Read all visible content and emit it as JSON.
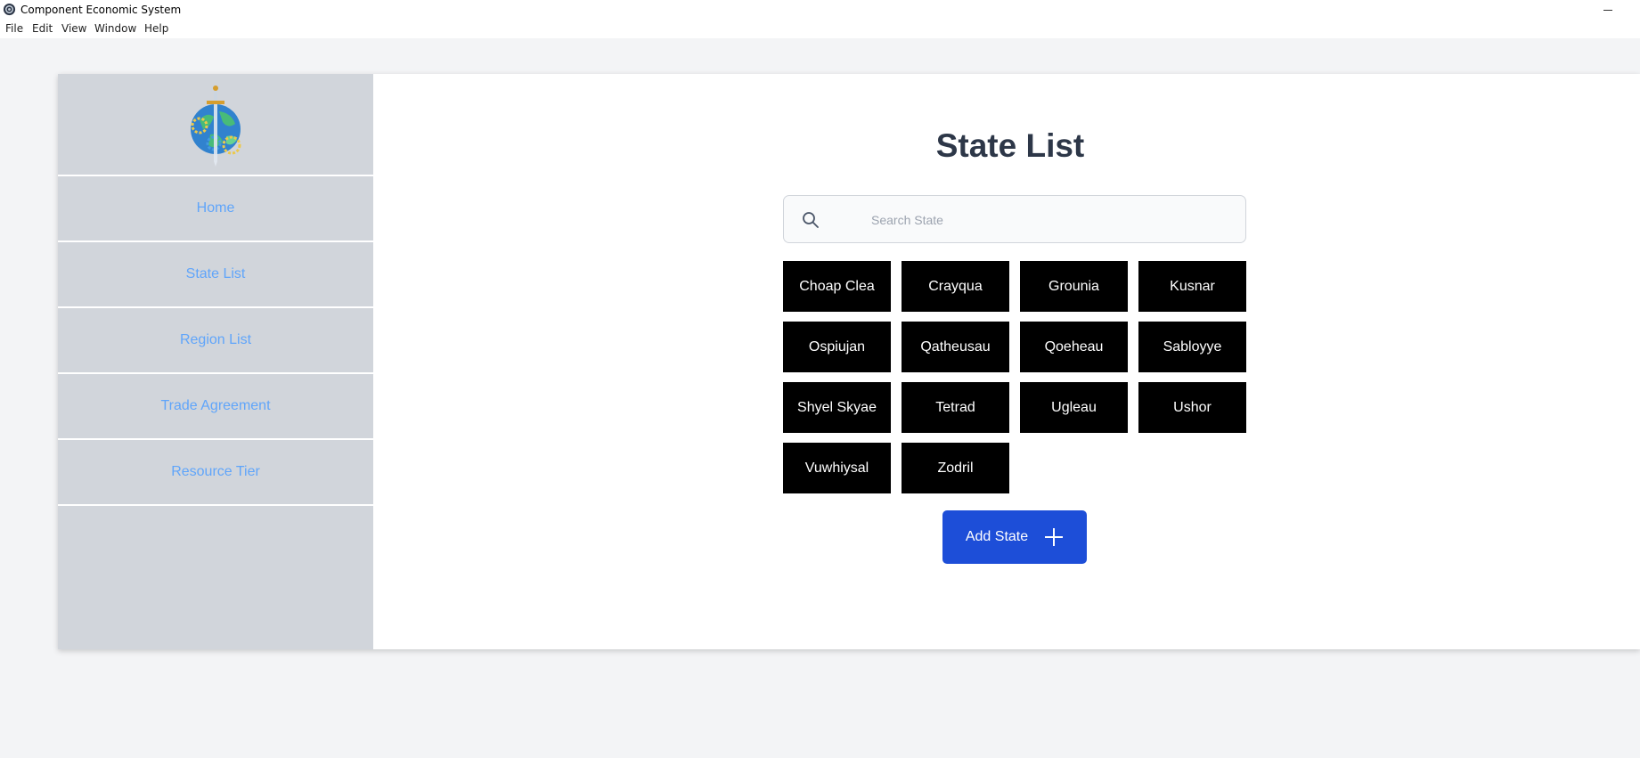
{
  "window": {
    "title": "Component Economic System",
    "app_icon": "gear-globe-icon"
  },
  "menubar": {
    "items": [
      "File",
      "Edit",
      "View",
      "Window",
      "Help"
    ]
  },
  "sidebar": {
    "logo": "globe-sword-gears-logo",
    "items": [
      {
        "label": "Home"
      },
      {
        "label": "State List"
      },
      {
        "label": "Region List"
      },
      {
        "label": "Trade Agreement"
      },
      {
        "label": "Resource Tier"
      }
    ],
    "link_color": "#60a5fa",
    "background": "#d1d5db"
  },
  "main": {
    "title": "State List",
    "search": {
      "placeholder": "Search State",
      "value": ""
    },
    "states": [
      "Choap Clea",
      "Crayqua",
      "Grounia",
      "Kusnar",
      "Ospiujan",
      "Qatheusau",
      "Qoeheau",
      "Sabloyye",
      "Shyel Skyae",
      "Tetrad",
      "Ugleau",
      "Ushor",
      "Vuwhiysal",
      "Zodril"
    ],
    "add_button": {
      "label": "Add State",
      "icon": "plus-icon",
      "color": "#1d4ed8"
    }
  }
}
